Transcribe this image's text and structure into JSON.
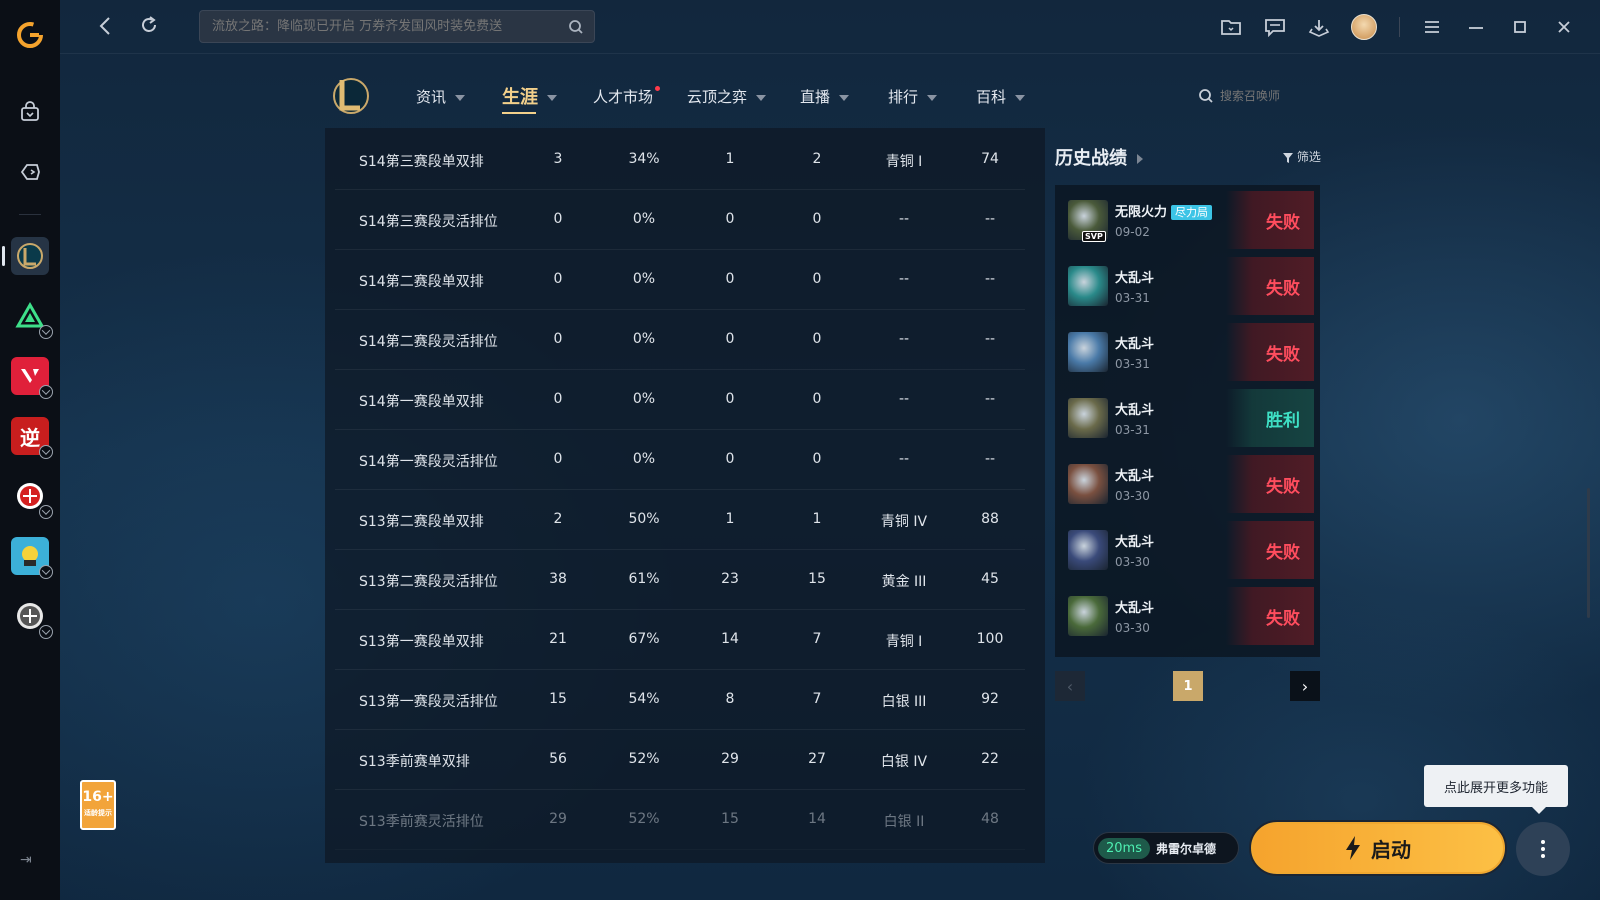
{
  "top_bar": {
    "search_placeholder": "流放之路：降临现已开启 万券齐发国风时装免费送"
  },
  "game_nav": {
    "items": [
      {
        "label": "资讯",
        "caret": true
      },
      {
        "label": "生涯",
        "caret": true,
        "active": true
      },
      {
        "label": "人才市场",
        "dot": true
      },
      {
        "label": "云顶之弈",
        "caret": true
      },
      {
        "label": "直播",
        "caret": true
      },
      {
        "label": "排行",
        "caret": true
      },
      {
        "label": "百科",
        "caret": true
      }
    ],
    "search_placeholder": "搜索召唤师"
  },
  "stats_table": {
    "rows": [
      [
        "S14第三赛段单双排",
        "3",
        "34%",
        "1",
        "2",
        "青铜 I",
        "74"
      ],
      [
        "S14第三赛段灵活排位",
        "0",
        "0%",
        "0",
        "0",
        "--",
        "--"
      ],
      [
        "S14第二赛段单双排",
        "0",
        "0%",
        "0",
        "0",
        "--",
        "--"
      ],
      [
        "S14第二赛段灵活排位",
        "0",
        "0%",
        "0",
        "0",
        "--",
        "--"
      ],
      [
        "S14第一赛段单双排",
        "0",
        "0%",
        "0",
        "0",
        "--",
        "--"
      ],
      [
        "S14第一赛段灵活排位",
        "0",
        "0%",
        "0",
        "0",
        "--",
        "--"
      ],
      [
        "S13第二赛段单双排",
        "2",
        "50%",
        "1",
        "1",
        "青铜 IV",
        "88"
      ],
      [
        "S13第二赛段灵活排位",
        "38",
        "61%",
        "23",
        "15",
        "黄金 III",
        "45"
      ],
      [
        "S13第一赛段单双排",
        "21",
        "67%",
        "14",
        "7",
        "青铜 I",
        "100"
      ],
      [
        "S13第一赛段灵活排位",
        "15",
        "54%",
        "8",
        "7",
        "白银 III",
        "92"
      ],
      [
        "S13季前赛单双排",
        "56",
        "52%",
        "29",
        "27",
        "白银 IV",
        "22"
      ],
      [
        "S13季前赛灵活排位",
        "29",
        "52%",
        "15",
        "14",
        "白银 II",
        "48"
      ]
    ]
  },
  "history": {
    "title": "历史战绩",
    "filter_label": "筛选",
    "matches": [
      {
        "mode": "无限火力",
        "tag": "尽力局",
        "date": "09-02",
        "result": "失败",
        "win": false,
        "svp": "SVP",
        "color": "#4a5a3a"
      },
      {
        "mode": "大乱斗",
        "tag": "",
        "date": "03-31",
        "result": "失败",
        "win": false,
        "svp": "",
        "color": "#2a8a8a"
      },
      {
        "mode": "大乱斗",
        "tag": "",
        "date": "03-31",
        "result": "失败",
        "win": false,
        "svp": "",
        "color": "#4a7aa8"
      },
      {
        "mode": "大乱斗",
        "tag": "",
        "date": "03-31",
        "result": "胜利",
        "win": true,
        "svp": "",
        "color": "#6a6a4a"
      },
      {
        "mode": "大乱斗",
        "tag": "",
        "date": "03-30",
        "result": "失败",
        "win": false,
        "svp": "",
        "color": "#7a5040"
      },
      {
        "mode": "大乱斗",
        "tag": "",
        "date": "03-30",
        "result": "失败",
        "win": false,
        "svp": "",
        "color": "#3a4a7a"
      },
      {
        "mode": "大乱斗",
        "tag": "",
        "date": "03-30",
        "result": "失败",
        "win": false,
        "svp": "",
        "color": "#4a6a3a"
      }
    ],
    "page": "1"
  },
  "bottom": {
    "tooltip": "点此展开更多功能",
    "ping": "20ms",
    "server": "弗雷尔卓德",
    "launch_label": "启动"
  },
  "age_rating": {
    "label": "16+",
    "sub": "适龄提示"
  }
}
